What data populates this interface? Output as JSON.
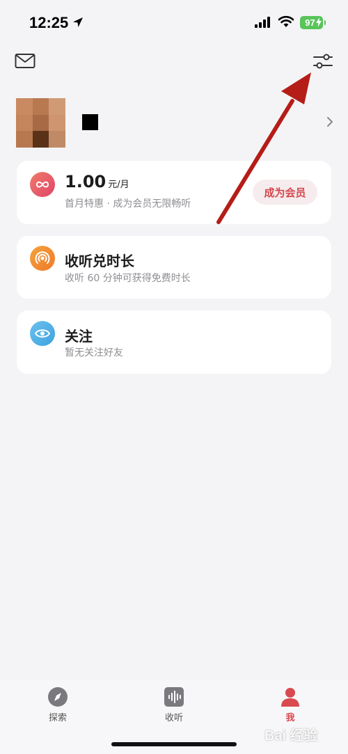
{
  "status_bar": {
    "time": "12:25",
    "battery": "97",
    "battery_color": "#58c45a",
    "icons": [
      "location-arrow-icon",
      "cellular-signal-icon",
      "wifi-icon",
      "battery-icon"
    ]
  },
  "header": {
    "icons": [
      "mail-icon",
      "settings-sliders-icon"
    ]
  },
  "profile": {
    "chevron_icon": "chevron-right-icon"
  },
  "membership_card": {
    "icon": "infinity-icon",
    "price": "1.00",
    "unit": "元/月",
    "subtitle": "首月特惠 · 成为会员无限畅听",
    "button_label": "成为会员",
    "accent": "#d4474d"
  },
  "listen_card": {
    "icon": "broadcast-icon",
    "title": "收听兑时长",
    "subtitle": "收听 60 分钟可获得免费时长"
  },
  "follow_card": {
    "icon": "eye-icon",
    "title": "关注",
    "subtitle": "暂无关注好友"
  },
  "tab_bar": {
    "tabs": [
      {
        "label": "探索",
        "icon": "compass-icon"
      },
      {
        "label": "收听",
        "icon": "audio-wave-icon"
      },
      {
        "label": "我",
        "icon": "person-icon",
        "active": true
      }
    ],
    "active_color": "#d94a50"
  },
  "watermark": "Bai 经验"
}
